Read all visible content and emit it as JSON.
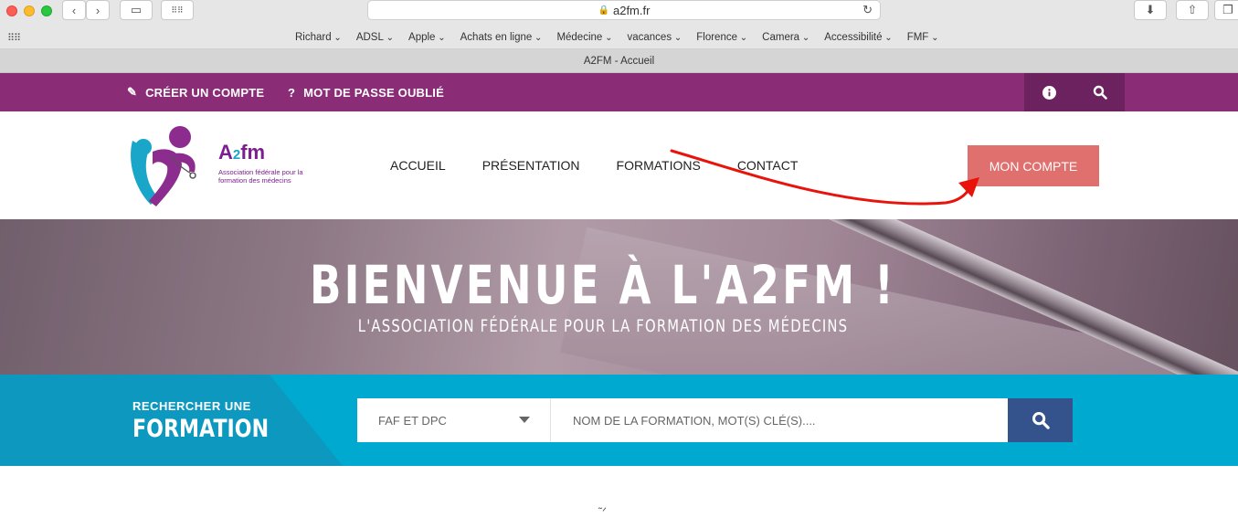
{
  "browser": {
    "url": "a2fm.fr",
    "tab_title": "A2FM - Accueil",
    "bookmarks": [
      "Richard",
      "ADSL",
      "Apple",
      "Achats en ligne",
      "Médecine",
      "vacances",
      "Florence",
      "Camera",
      "Accessibilité",
      "FMF"
    ]
  },
  "topbar": {
    "create_account": "CRÉER UN COMPTE",
    "forgot_password": "MOT DE PASSE OUBLIÉ"
  },
  "header": {
    "logo_text": "A2fm",
    "logo_line1": "Association fédérale pour la",
    "logo_line2": "formation des médecins",
    "nav": [
      "ACCUEIL",
      "PRÉSENTATION",
      "FORMATIONS",
      "CONTACT"
    ],
    "account_button": "MON COMPTE"
  },
  "hero": {
    "title": "BIENVENUE À L'A2FM !",
    "subtitle": "L'ASSOCIATION FÉDÉRALE POUR LA FORMATION DES MÉDECINS"
  },
  "search": {
    "label_small": "RECHERCHER UNE",
    "label_big": "FORMATION",
    "category_selected": "FAF ET DPC",
    "placeholder": "NOM DE LA FORMATION, MOT(S) CLÉ(S)...."
  },
  "colors": {
    "purple": "#8b2c77",
    "account_button": "#e0706e",
    "search_band": "#00a9d0",
    "search_button": "#34538c",
    "annotation_arrow": "#e8140c"
  }
}
